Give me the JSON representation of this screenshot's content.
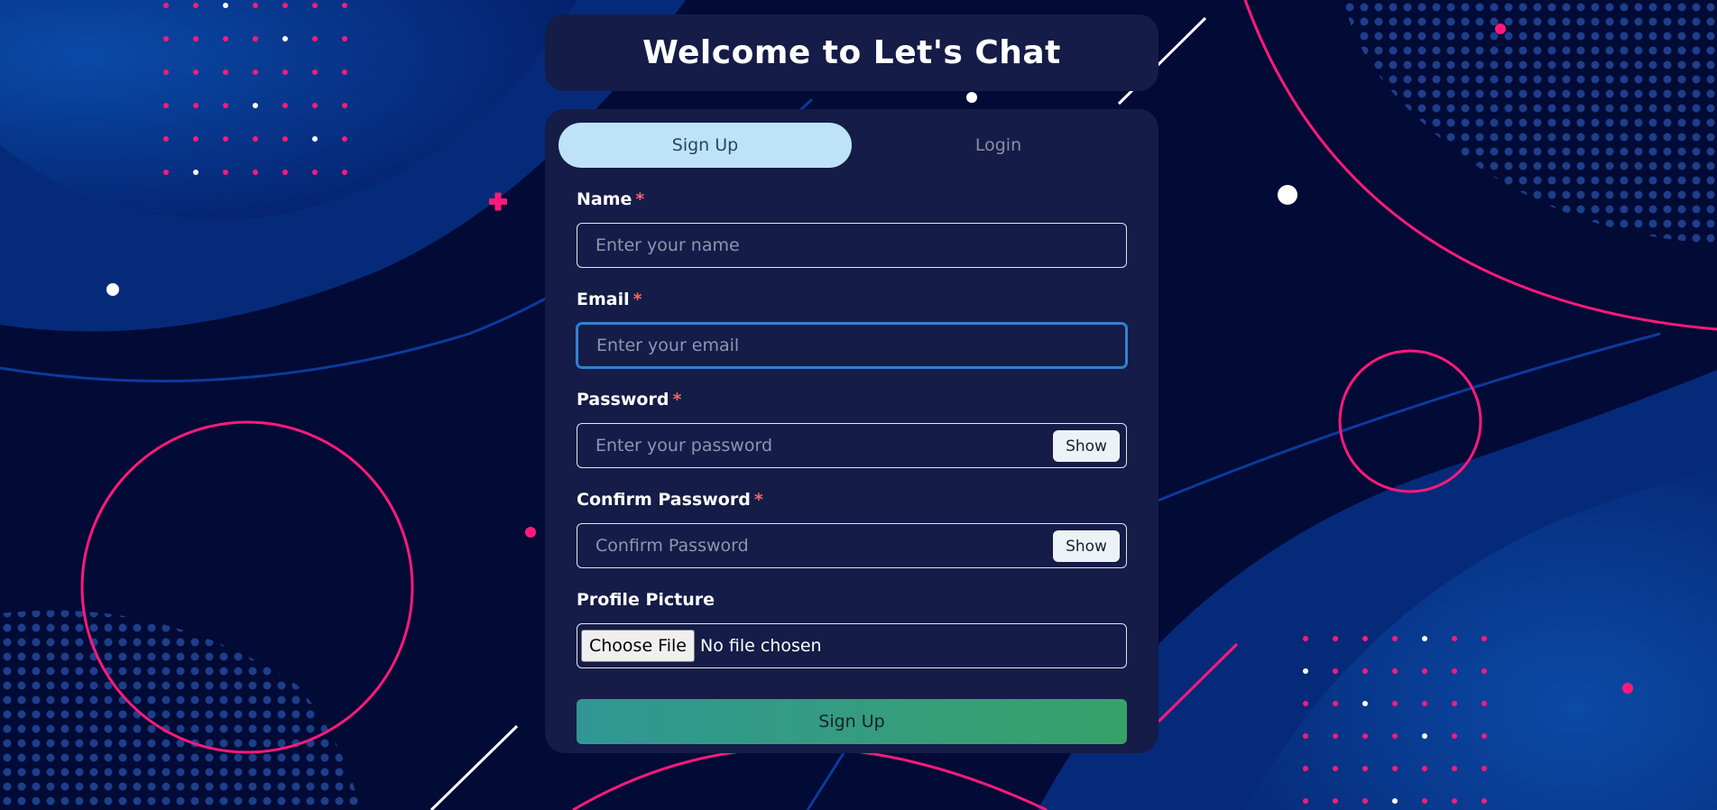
{
  "header": {
    "title": "Welcome to Let's Chat"
  },
  "tabs": [
    {
      "label": "Sign Up",
      "active": true
    },
    {
      "label": "Login",
      "active": false
    }
  ],
  "form": {
    "name": {
      "label": "Name",
      "required_mark": "*",
      "placeholder": "Enter your name",
      "value": ""
    },
    "email": {
      "label": "Email",
      "required_mark": "*",
      "placeholder": "Enter your email",
      "value": ""
    },
    "password": {
      "label": "Password",
      "required_mark": "*",
      "placeholder": "Enter your password",
      "value": "",
      "toggle_label": "Show"
    },
    "confirm_password": {
      "label": "Confirm Password",
      "required_mark": "*",
      "placeholder": "Confirm Password",
      "value": "",
      "toggle_label": "Show"
    },
    "profile_picture": {
      "label": "Profile Picture",
      "button_label": "Choose File",
      "status": "No file chosen"
    },
    "submit_label": "Sign Up"
  },
  "colors": {
    "background": "#020a36",
    "card": "#141c47",
    "active_tab": "#bee3f8",
    "accent_pink": "#ff1a7a",
    "accent_blue": "#0b3b8c",
    "submit_gradient_start": "#319795",
    "submit_gradient_end": "#38a169",
    "focus_ring": "#3182ce"
  }
}
